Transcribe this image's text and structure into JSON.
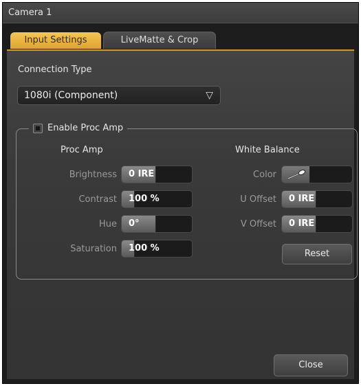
{
  "window": {
    "title": "Camera 1"
  },
  "tabs": [
    {
      "label": "Input Settings",
      "active": true
    },
    {
      "label": "LiveMatte & Crop",
      "active": false
    }
  ],
  "connection": {
    "label": "Connection Type",
    "value": "1080i (Component)",
    "arrow_icon": "triangle-down-icon"
  },
  "proc_amp": {
    "enable_label": "Enable Proc Amp",
    "enabled": true,
    "heading": "Proc Amp",
    "controls": [
      {
        "label": "Brightness",
        "value": "0 IRE",
        "level": 0.48
      },
      {
        "label": "Contrast",
        "value": "100 %",
        "level": 0.18
      },
      {
        "label": "Hue",
        "value": "0°",
        "level": 0.48
      },
      {
        "label": "Saturation",
        "value": "100 %",
        "level": 0.18
      }
    ]
  },
  "white_balance": {
    "heading": "White Balance",
    "color_label": "Color",
    "color_icon": "eyedropper-icon",
    "controls": [
      {
        "label": "U Offset",
        "value": "0 IRE",
        "level": 0.48
      },
      {
        "label": "V Offset",
        "value": "0 IRE",
        "level": 0.48
      }
    ],
    "reset_label": "Reset"
  },
  "footer": {
    "close_label": "Close"
  },
  "colors": {
    "accent": "#e2a83a",
    "panel": "#3a3a3a",
    "titlebar": "#404040"
  }
}
